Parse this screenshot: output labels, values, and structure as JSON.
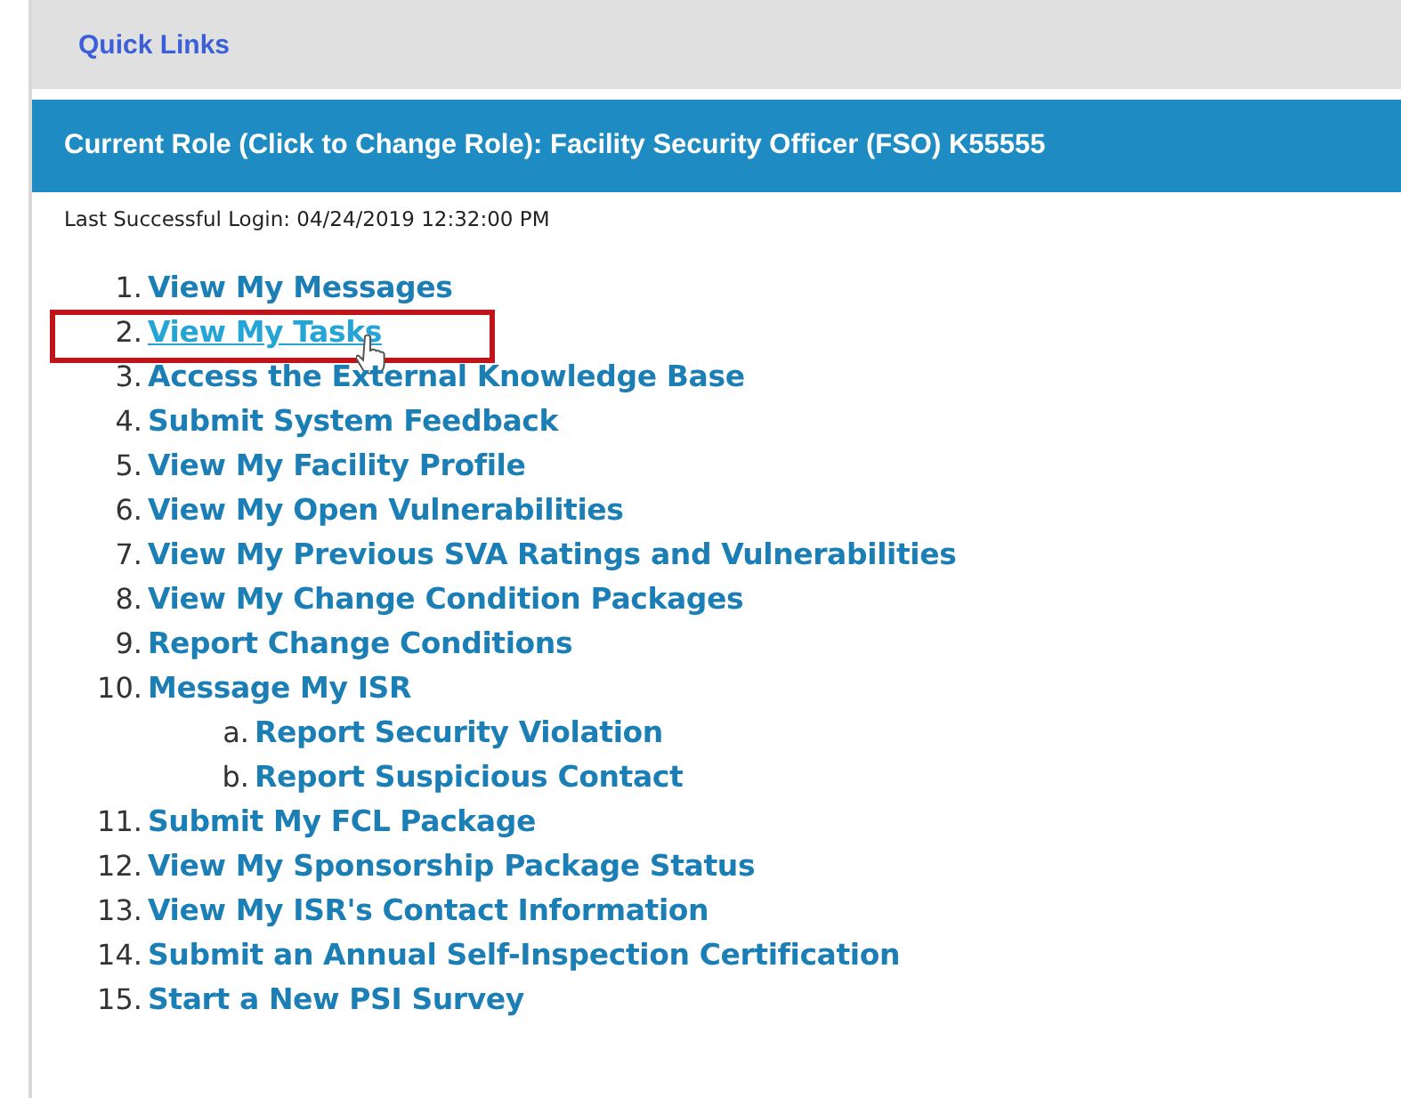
{
  "header": {
    "title": "Quick Links"
  },
  "role_bar": {
    "text": "Current Role (Click to Change Role): Facility Security Officer (FSO) K55555"
  },
  "last_login": "Last Successful Login: 04/24/2019 12:32:00 PM",
  "links": [
    {
      "number": "1.",
      "label": "View My Messages",
      "hovered": false,
      "highlighted": false
    },
    {
      "number": "2.",
      "label": "View My Tasks",
      "hovered": true,
      "highlighted": true
    },
    {
      "number": "3.",
      "label": "Access the External Knowledge Base",
      "hovered": false,
      "highlighted": false
    },
    {
      "number": "4.",
      "label": "Submit System Feedback",
      "hovered": false,
      "highlighted": false
    },
    {
      "number": "5.",
      "label": "View My Facility Profile",
      "hovered": false,
      "highlighted": false
    },
    {
      "number": "6.",
      "label": "View My Open Vulnerabilities",
      "hovered": false,
      "highlighted": false
    },
    {
      "number": "7.",
      "label": "View My Previous SVA Ratings and Vulnerabilities",
      "hovered": false,
      "highlighted": false
    },
    {
      "number": "8.",
      "label": "View My Change Condition Packages",
      "hovered": false,
      "highlighted": false
    },
    {
      "number": "9.",
      "label": "Report Change Conditions",
      "hovered": false,
      "highlighted": false
    },
    {
      "number": "10.",
      "label": "Message My ISR",
      "hovered": false,
      "highlighted": false,
      "children": [
        {
          "number": "a.",
          "label": "Report Security Violation",
          "hovered": false,
          "highlighted": false
        },
        {
          "number": "b.",
          "label": "Report Suspicious Contact",
          "hovered": false,
          "highlighted": false
        }
      ]
    },
    {
      "number": "11.",
      "label": "Submit My FCL Package",
      "hovered": false,
      "highlighted": false
    },
    {
      "number": "12.",
      "label": "View My Sponsorship Package Status",
      "hovered": false,
      "highlighted": false
    },
    {
      "number": "13.",
      "label": "View My ISR's Contact Information",
      "hovered": false,
      "highlighted": false
    },
    {
      "number": "14.",
      "label": "Submit an Annual Self-Inspection Certification",
      "hovered": false,
      "highlighted": false
    },
    {
      "number": "15.",
      "label": "Start a New PSI Survey",
      "hovered": false,
      "highlighted": false
    }
  ]
}
